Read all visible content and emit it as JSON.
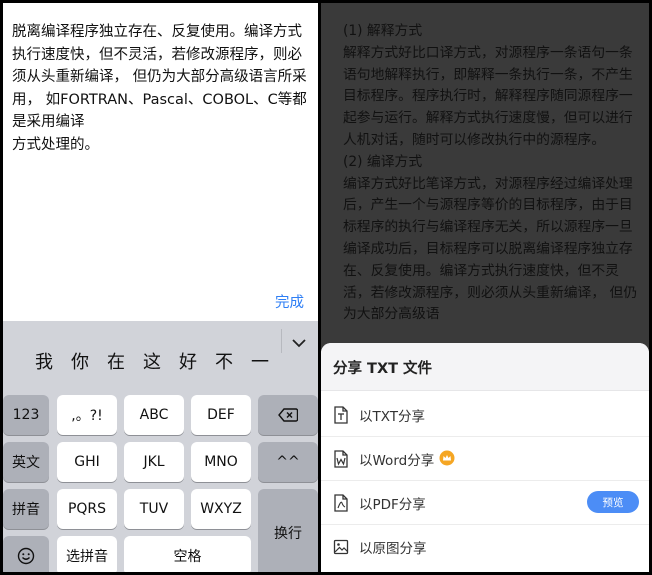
{
  "editor": {
    "text": "脱离编译程序独立存在、反复使用。编译方式执行速度快，但不灵活，若修改源程序，则必须从头重新编译， 但仍为大部分高级语言所采用， 如FORTRAN、Pascal、COBOL、C等都是采用编译\n方式处理的。",
    "done_label": "完成"
  },
  "keyboard": {
    "candidates": [
      "我",
      "你",
      "在",
      "这",
      "好",
      "不",
      "一"
    ],
    "more_icon": "chevron-down-icon",
    "keys": {
      "num": "123",
      "punct": ",。?!",
      "abc": "ABC",
      "def": "DEF",
      "backspace_icon": "backspace-icon",
      "english": "英文",
      "ghi": "GHI",
      "jkl": "JKL",
      "mno": "MNO",
      "caret": "^^",
      "pinyin": "拼音",
      "pqrs": "PQRS",
      "tuv": "TUV",
      "wxyz": "WXYZ",
      "enter": "换行",
      "emoji_icon": "emoji-icon",
      "select_pinyin": "选拼音",
      "space": "空格"
    }
  },
  "document": {
    "paragraphs": [
      "(1) 解释方式",
      "解释方式好比口译方式，对源程序一条语句一条语句地解释执行，即解释一条执行一条，不产生目标程序。程序执行时，解释程序随同源程序一起参与运行。解释方式执行速度慢，但可以进行人机对话，随时可以修改执行中的源程序。",
      "(2) 编译方式",
      "编译方式好比笔译方式，对源程序经过编译处理后，产生一个与源程序等价的目标程序，由于目标程序的执行与编译程序无关，所以源程序一旦编译成功后，目标程序可以脱离编译程序独立存在、反复使用。编译方式执行速度快，但不灵活，若修改源程序，则必须从头重新编译， 但仍为大部分高级语"
    ]
  },
  "share_sheet": {
    "title": "分享 TXT 文件",
    "options": [
      {
        "label": "以TXT分享",
        "icon": "txt-file-icon"
      },
      {
        "label": "以Word分享",
        "icon": "word-file-icon",
        "badge_icon": "crown-icon"
      },
      {
        "label": "以PDF分享",
        "icon": "pdf-file-icon",
        "button": "预览"
      },
      {
        "label": "以原图分享",
        "icon": "image-icon"
      }
    ]
  },
  "colors": {
    "accent": "#2f7ff5",
    "preview_button": "#4c8df6",
    "crown": "#f5a623",
    "overlay": "#3a3a3a"
  }
}
